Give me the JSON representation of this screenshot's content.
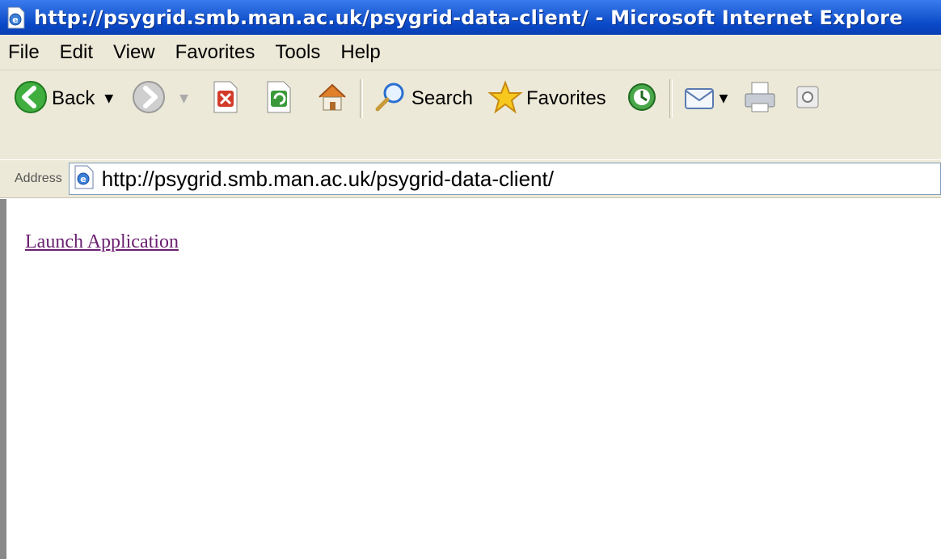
{
  "window": {
    "title": "http://psygrid.smb.man.ac.uk/psygrid-data-client/ - Microsoft Internet Explore"
  },
  "menubar": {
    "items": [
      "File",
      "Edit",
      "View",
      "Favorites",
      "Tools",
      "Help"
    ]
  },
  "toolbar": {
    "back_label": "Back",
    "search_label": "Search",
    "favorites_label": "Favorites"
  },
  "address": {
    "label": "Address",
    "url": "http://psygrid.smb.man.ac.uk/psygrid-data-client/"
  },
  "content": {
    "link_text": "Launch Application"
  },
  "colors": {
    "titlebar": "#0a49c8",
    "chrome": "#ece9d8",
    "visited_link": "#6a2070"
  }
}
